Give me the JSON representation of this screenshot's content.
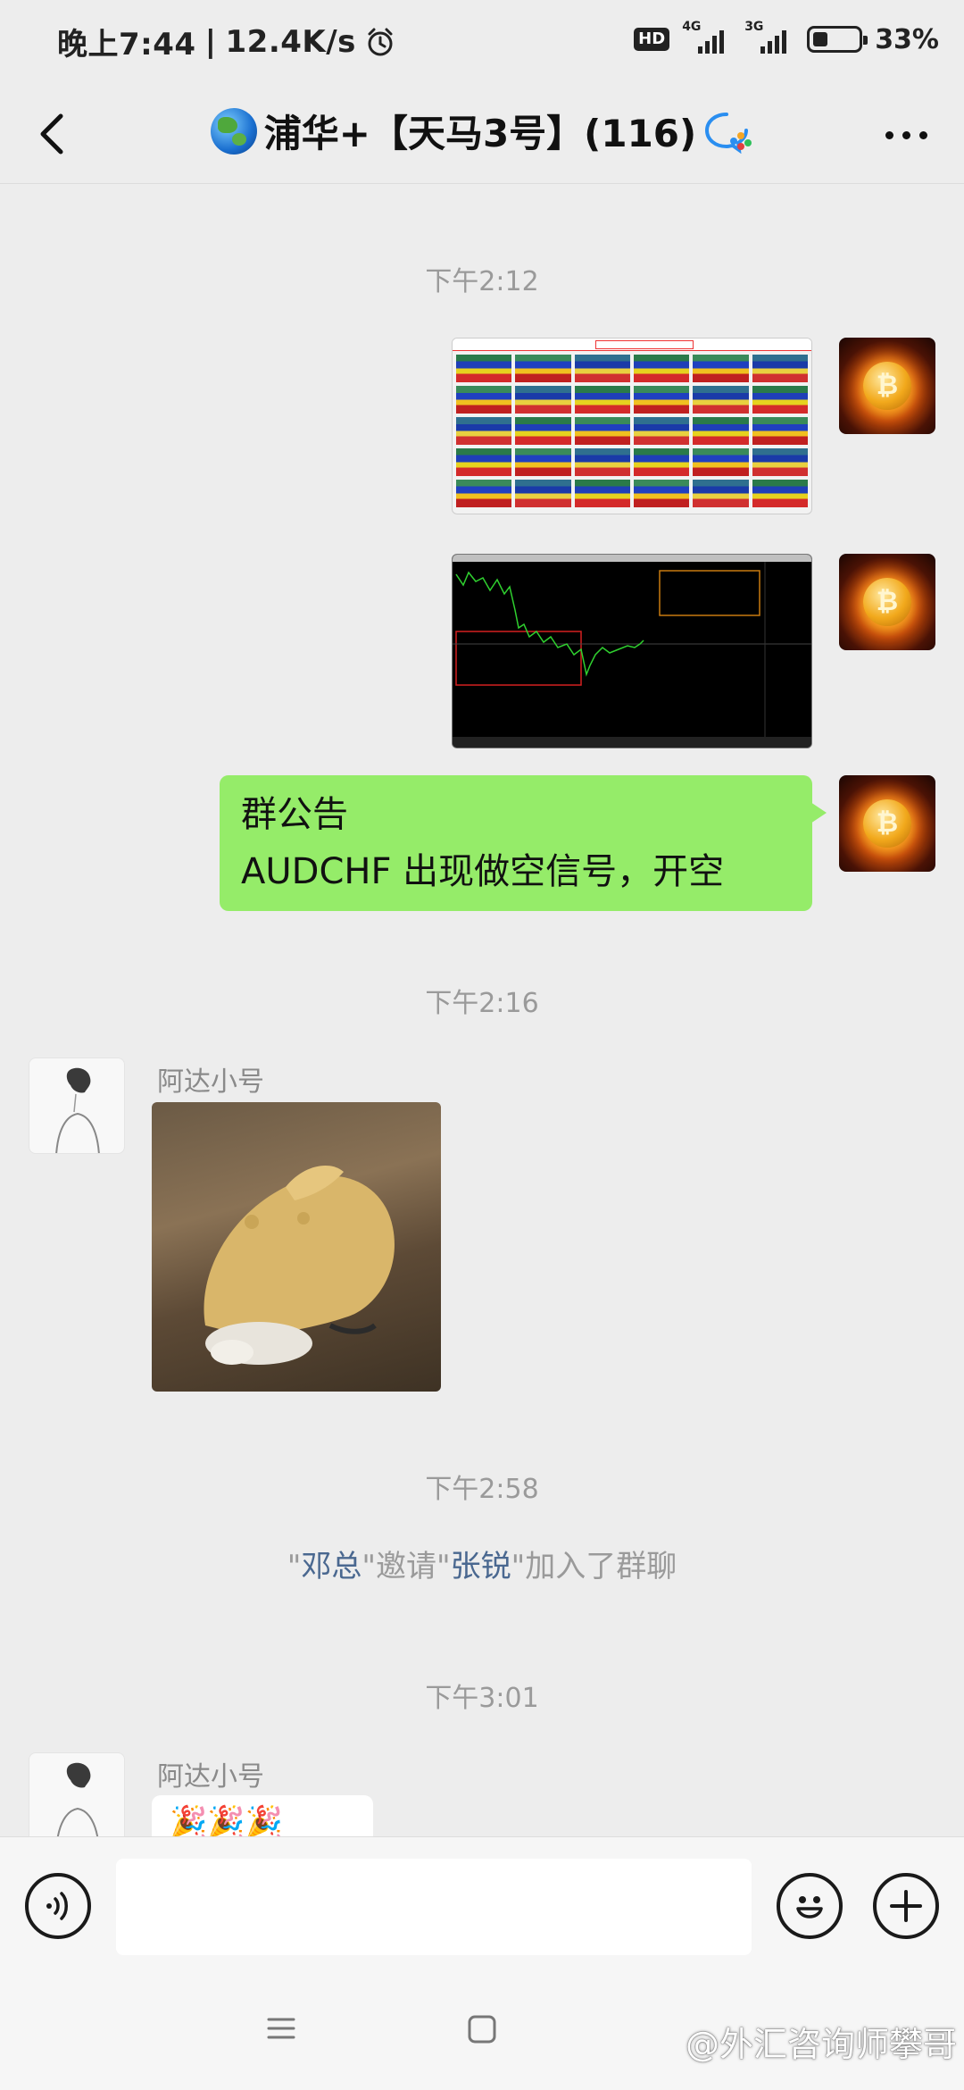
{
  "status_bar": {
    "time": "晚上7:44",
    "speed": "12.4K/s",
    "hd": "HD",
    "net1": "4G",
    "net2": "3G",
    "battery": "33%"
  },
  "header": {
    "title": "浦华+【天马3号】(116)"
  },
  "messages": {
    "ts1": "下午2:12",
    "notice_title": "群公告",
    "notice_body": "AUDCHF 出现做空信号，开空",
    "ts2": "下午2:16",
    "sender1": "阿达小号",
    "ts3": "下午2:58",
    "sys_q1": "\"",
    "sys_name1": "邓总",
    "sys_mid": "\"邀请\"",
    "sys_name2": "张锐",
    "sys_end": "\"加入了群聊",
    "ts4": "下午3:01",
    "sender2": "阿达小号",
    "emoji_text": "🎉🎉🎉"
  },
  "input": {
    "placeholder": ""
  },
  "watermark": "@外汇咨询师攀哥",
  "icons": {
    "back": "back-arrow-icon",
    "more": "more-dots-icon",
    "voice": "voice-icon",
    "emoji": "emoji-icon",
    "plus": "plus-icon"
  },
  "colors": {
    "bubble_green": "#95ec69",
    "background": "#ededed",
    "sys_name": "#4a6890"
  }
}
